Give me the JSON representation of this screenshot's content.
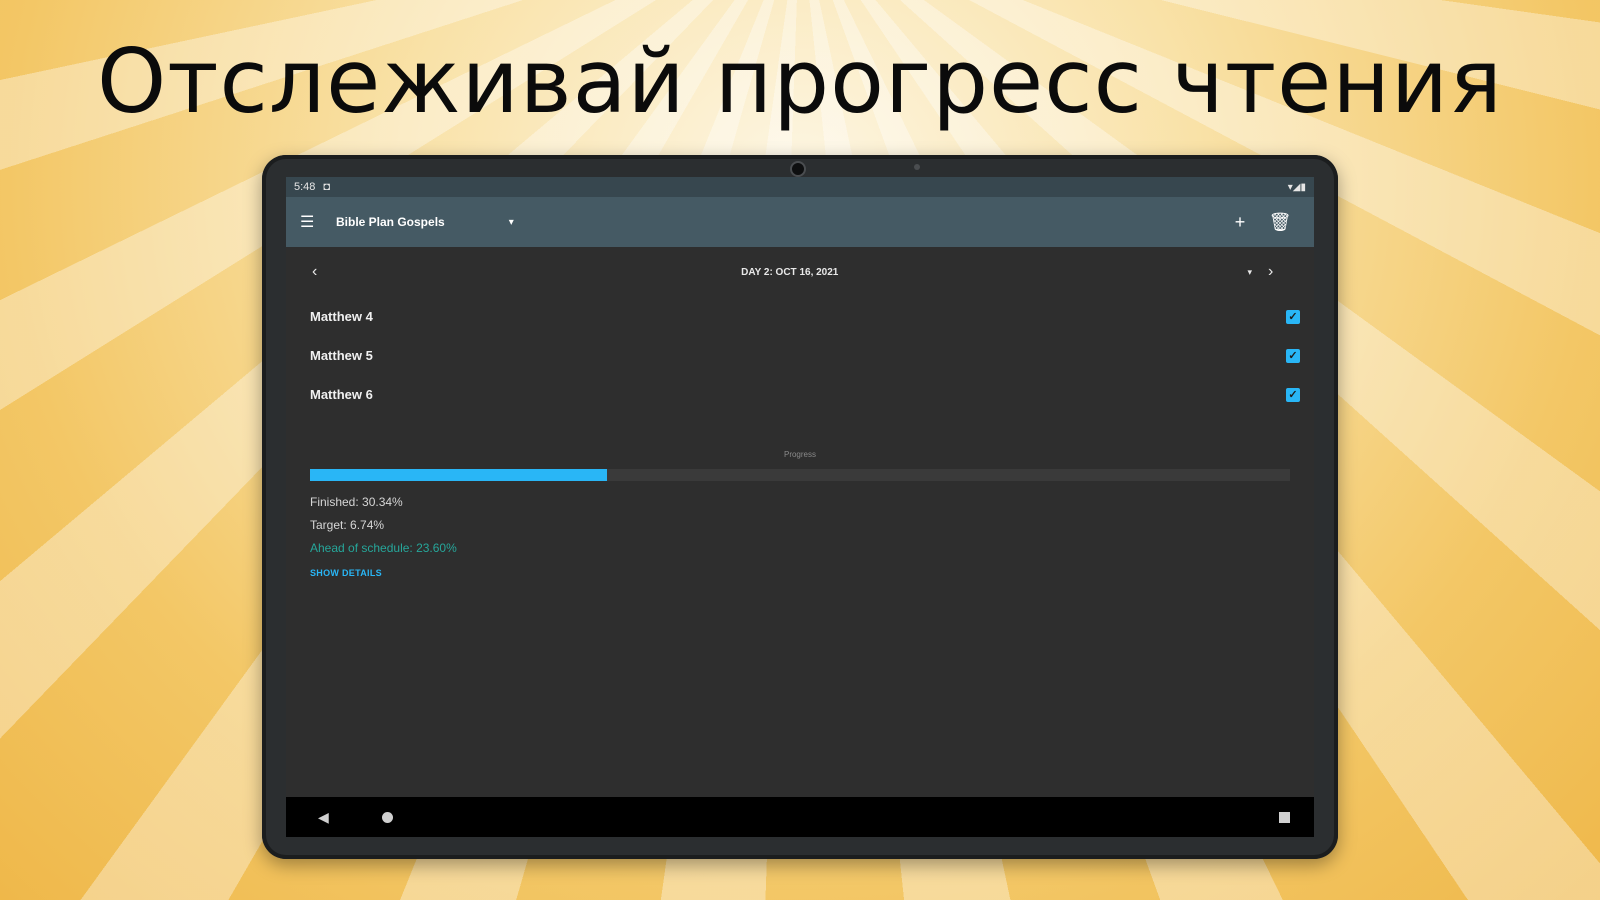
{
  "headline": "Отслеживай прогресс чтения",
  "status_bar": {
    "time": "5:48",
    "notification_icon": "app-icon",
    "right_icons": "▾◢▮"
  },
  "app_bar": {
    "menu_icon": "☰",
    "plan_title": "Bible Plan Gospels",
    "dropdown_glyph": "▾",
    "add_icon": "+",
    "delete_icon": "🗑"
  },
  "day_nav": {
    "prev_glyph": "‹",
    "label": "DAY 2: OCT 16, 2021",
    "caret_glyph": "▾",
    "next_glyph": "›"
  },
  "readings": [
    {
      "label": "Matthew 4",
      "checked": true,
      "check_glyph": "✓"
    },
    {
      "label": "Matthew 5",
      "checked": true,
      "check_glyph": "✓"
    },
    {
      "label": "Matthew 6",
      "checked": true,
      "check_glyph": "✓"
    }
  ],
  "progress": {
    "label": "Progress",
    "fraction": 0.3034,
    "finished": "Finished: 30.34%",
    "target": "Target: 6.74%",
    "ahead": "Ahead of schedule: 23.60%",
    "show_details": "SHOW DETAILS"
  },
  "colors": {
    "accent": "#29b6f6",
    "ahead": "#26a69a",
    "app_bar": "#455a64",
    "status_bar": "#37474f"
  }
}
